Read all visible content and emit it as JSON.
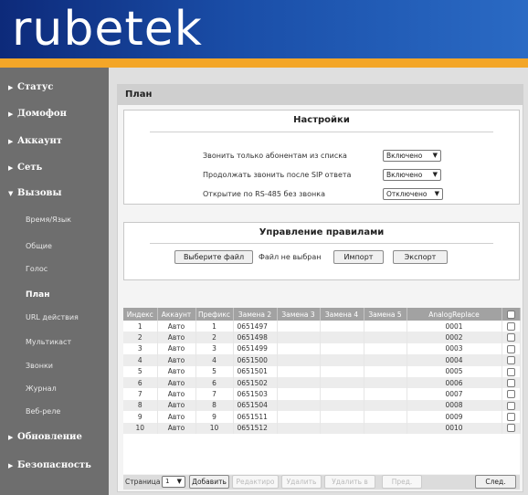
{
  "brand": {
    "logo_text": "rubetek"
  },
  "colors": {
    "header": "#1a4ea8",
    "stripe": "#f3a628",
    "sidebar": "#6e6e6e",
    "table_header": "#a2a2a2"
  },
  "sidebar": {
    "status": "Статус",
    "intercom": "Домофон",
    "account": "Аккаунт",
    "network": "Сеть",
    "calls": "Вызовы",
    "sub": {
      "time_lang": "Время/Язык",
      "general": "Общие",
      "voice": "Голос",
      "plan": "План",
      "url_actions": "URL действия",
      "multicast": "Мультикаст",
      "ringtones": "Звонки",
      "log": "Журнал",
      "web_relay": "Веб-реле"
    },
    "update": "Обновление",
    "security": "Безопасность"
  },
  "page": {
    "title": "План"
  },
  "settings": {
    "title": "Настройки",
    "rows": [
      {
        "label": "Звонить только абонентам из списка",
        "value": "Включено"
      },
      {
        "label": "Продолжать звонить после SIP ответа",
        "value": "Включено"
      },
      {
        "label": "Открытие по RS-485 без звонка",
        "value": "Отключено"
      }
    ]
  },
  "rules": {
    "title": "Управление правилами",
    "choose_file": "Выберите файл",
    "no_file": "Файл не выбран",
    "import": "Импорт",
    "export": "Экспорт"
  },
  "table": {
    "headers": [
      "Индекс",
      "Аккаунт",
      "Префикс",
      "Замена 2",
      "Замена 3",
      "Замена 4",
      "Замена 5",
      "AnalogReplace"
    ],
    "rows": [
      [
        "1",
        "Авто",
        "1",
        "0651497",
        "",
        "",
        "",
        "0001"
      ],
      [
        "2",
        "Авто",
        "2",
        "0651498",
        "",
        "",
        "",
        "0002"
      ],
      [
        "3",
        "Авто",
        "3",
        "0651499",
        "",
        "",
        "",
        "0003"
      ],
      [
        "4",
        "Авто",
        "4",
        "0651500",
        "",
        "",
        "",
        "0004"
      ],
      [
        "5",
        "Авто",
        "5",
        "0651501",
        "",
        "",
        "",
        "0005"
      ],
      [
        "6",
        "Авто",
        "6",
        "0651502",
        "",
        "",
        "",
        "0006"
      ],
      [
        "7",
        "Авто",
        "7",
        "0651503",
        "",
        "",
        "",
        "0007"
      ],
      [
        "8",
        "Авто",
        "8",
        "0651504",
        "",
        "",
        "",
        "0008"
      ],
      [
        "9",
        "Авто",
        "9",
        "0651511",
        "",
        "",
        "",
        "0009"
      ],
      [
        "10",
        "Авто",
        "10",
        "0651512",
        "",
        "",
        "",
        "0010"
      ]
    ]
  },
  "footer": {
    "page_label": "Страница",
    "page_value": "1",
    "add": "Добавить",
    "edit": "Редактиро",
    "delete": "Удалить",
    "delete_all": "Удалить в",
    "prev": "Пред.",
    "next": "След."
  }
}
